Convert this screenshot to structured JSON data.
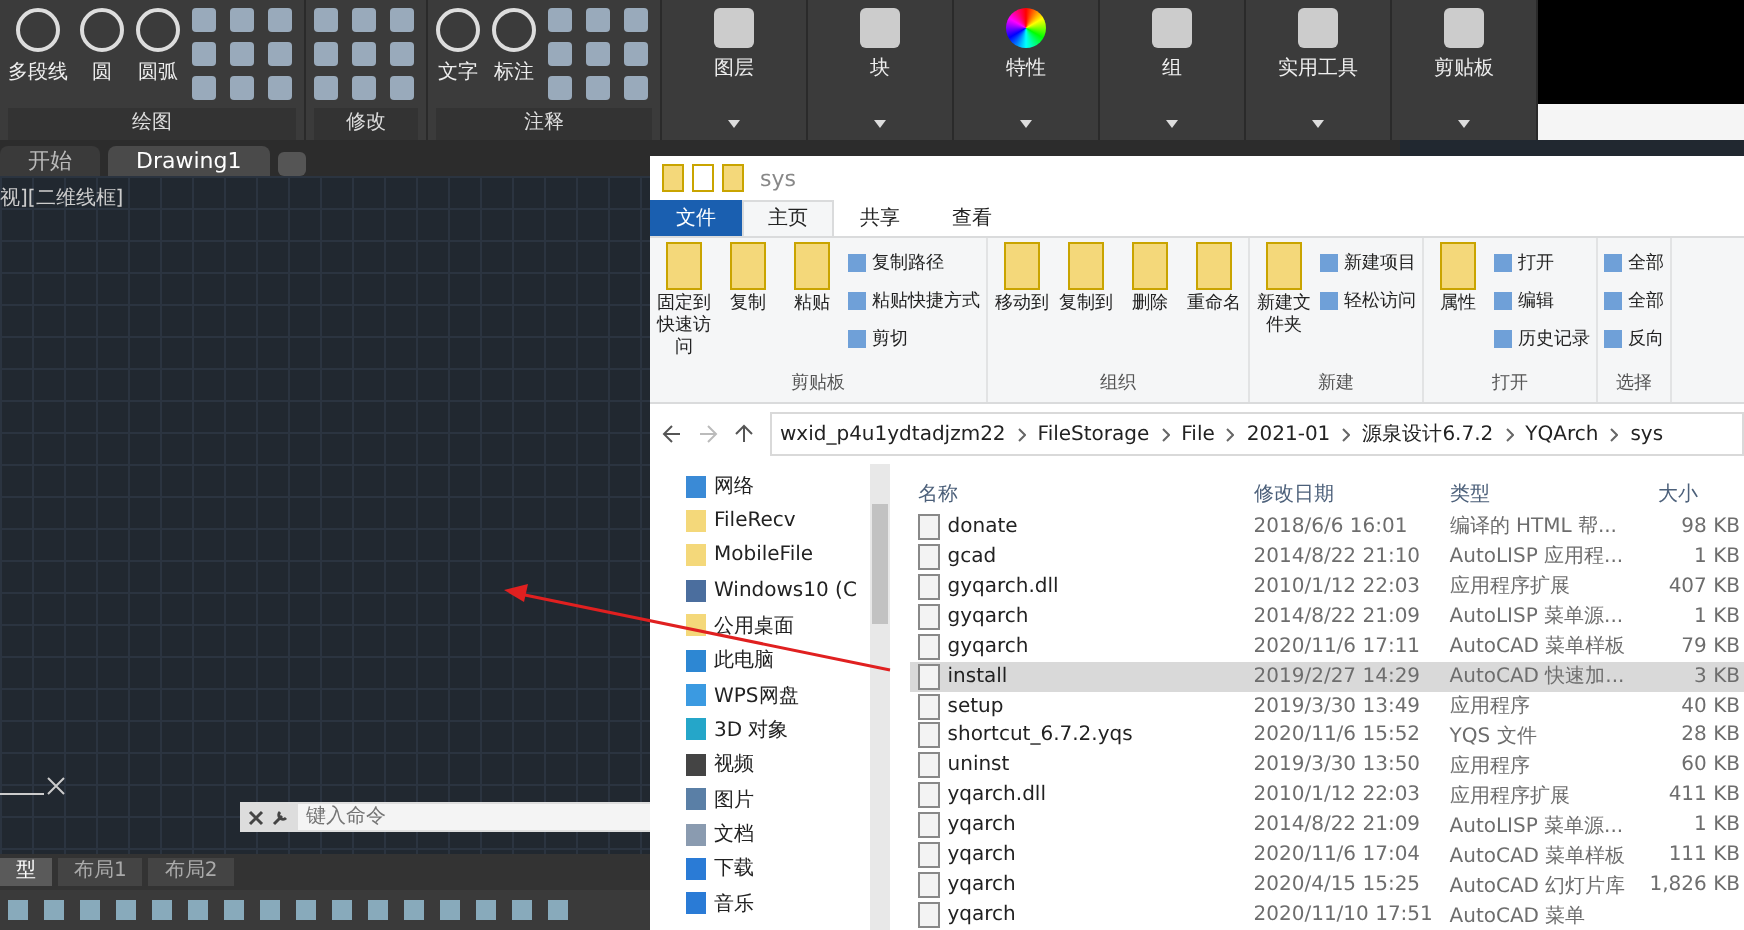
{
  "cad": {
    "ribbon_groups": [
      {
        "label": "绘图",
        "tools": [
          "多段线",
          "圆",
          "圆弧"
        ]
      },
      {
        "label": "修改"
      },
      {
        "label": "注释",
        "tools": [
          "文字",
          "标注"
        ]
      }
    ],
    "ribbon_panels": [
      "图层",
      "块",
      "特性",
      "组",
      "实用工具",
      "剪贴板"
    ],
    "file_tabs": [
      {
        "label": "开始",
        "selected": false
      },
      {
        "label": "Drawing1",
        "selected": true
      }
    ],
    "viewport_label": "视][二维线框]",
    "command_placeholder": "键入命令",
    "layout_tabs": [
      {
        "label": "型",
        "selected": true
      },
      {
        "label": "布局1",
        "selected": false
      },
      {
        "label": "布局2",
        "selected": false
      }
    ]
  },
  "explorer": {
    "title": "sys",
    "tabs": [
      {
        "label": "文件",
        "kind": "file",
        "selected": false
      },
      {
        "label": "主页",
        "kind": "tab",
        "selected": true
      },
      {
        "label": "共享",
        "kind": "tab",
        "selected": false
      },
      {
        "label": "查看",
        "kind": "tab",
        "selected": false
      }
    ],
    "ribbon_groups": [
      {
        "label": "剪贴板",
        "large": [
          "固定到快速访问",
          "复制",
          "粘贴"
        ],
        "small": [
          "复制路径",
          "粘贴快捷方式",
          "剪切"
        ]
      },
      {
        "label": "组织",
        "large": [
          "移动到",
          "复制到",
          "删除",
          "重命名"
        ]
      },
      {
        "label": "新建",
        "large": [
          "新建文件夹"
        ],
        "small": [
          "新建项目",
          "轻松访问"
        ]
      },
      {
        "label": "打开",
        "large": [
          "属性"
        ],
        "small": [
          "打开",
          "编辑",
          "历史记录"
        ]
      },
      {
        "label": "选择",
        "small": [
          "全部",
          "全部",
          "反向"
        ]
      }
    ],
    "breadcrumb": [
      "wxid_p4u1ydtadjzm22",
      "FileStorage",
      "File",
      "2021-01",
      "源泉设计6.7.2",
      "YQArch",
      "sys"
    ],
    "nav": [
      {
        "label": "网络",
        "kind": "network"
      },
      {
        "label": "FileRecv",
        "kind": "folder"
      },
      {
        "label": "MobileFile",
        "kind": "folder"
      },
      {
        "label": "Windows10 (C",
        "kind": "drive"
      },
      {
        "label": "公用桌面",
        "kind": "folder"
      },
      {
        "label": "此电脑",
        "kind": "pc"
      },
      {
        "label": "WPS网盘",
        "kind": "cloud"
      },
      {
        "label": "3D 对象",
        "kind": "cube"
      },
      {
        "label": "视频",
        "kind": "video"
      },
      {
        "label": "图片",
        "kind": "picture"
      },
      {
        "label": "文档",
        "kind": "doc"
      },
      {
        "label": "下载",
        "kind": "download"
      },
      {
        "label": "音乐",
        "kind": "music"
      }
    ],
    "columns": [
      "名称",
      "修改日期",
      "类型",
      "大小"
    ],
    "rows": [
      {
        "name": "donate",
        "date": "2018/6/6 16:01",
        "type": "编译的 HTML 帮...",
        "size": "98 KB",
        "selected": false
      },
      {
        "name": "gcad",
        "date": "2014/8/22 21:10",
        "type": "AutoLISP 应用程...",
        "size": "1 KB",
        "selected": false
      },
      {
        "name": "gyqarch.dll",
        "date": "2010/1/12 22:03",
        "type": "应用程序扩展",
        "size": "407 KB",
        "selected": false
      },
      {
        "name": "gyqarch",
        "date": "2014/8/22 21:09",
        "type": "AutoLISP 菜单源...",
        "size": "1 KB",
        "selected": false
      },
      {
        "name": "gyqarch",
        "date": "2020/11/6 17:11",
        "type": "AutoCAD 菜单样板",
        "size": "79 KB",
        "selected": false
      },
      {
        "name": "install",
        "date": "2019/2/27 14:29",
        "type": "AutoCAD 快速加...",
        "size": "3 KB",
        "selected": true
      },
      {
        "name": "setup",
        "date": "2019/3/30 13:49",
        "type": "应用程序",
        "size": "40 KB",
        "selected": false
      },
      {
        "name": "shortcut_6.7.2.yqs",
        "date": "2020/11/6 15:52",
        "type": "YQS 文件",
        "size": "28 KB",
        "selected": false
      },
      {
        "name": "uninst",
        "date": "2019/3/30 13:50",
        "type": "应用程序",
        "size": "60 KB",
        "selected": false
      },
      {
        "name": "yqarch.dll",
        "date": "2010/1/12 22:03",
        "type": "应用程序扩展",
        "size": "411 KB",
        "selected": false
      },
      {
        "name": "yqarch",
        "date": "2014/8/22 21:09",
        "type": "AutoLISP 菜单源...",
        "size": "1 KB",
        "selected": false
      },
      {
        "name": "yqarch",
        "date": "2020/11/6 17:04",
        "type": "AutoCAD 菜单样板",
        "size": "111 KB",
        "selected": false
      },
      {
        "name": "yqarch",
        "date": "2020/4/15 15:25",
        "type": "AutoCAD 幻灯片库",
        "size": "1,826 KB",
        "selected": false
      },
      {
        "name": "yqarch",
        "date": "2020/11/10 17:51",
        "type": "AutoCAD 菜单",
        "selected": false
      }
    ]
  }
}
